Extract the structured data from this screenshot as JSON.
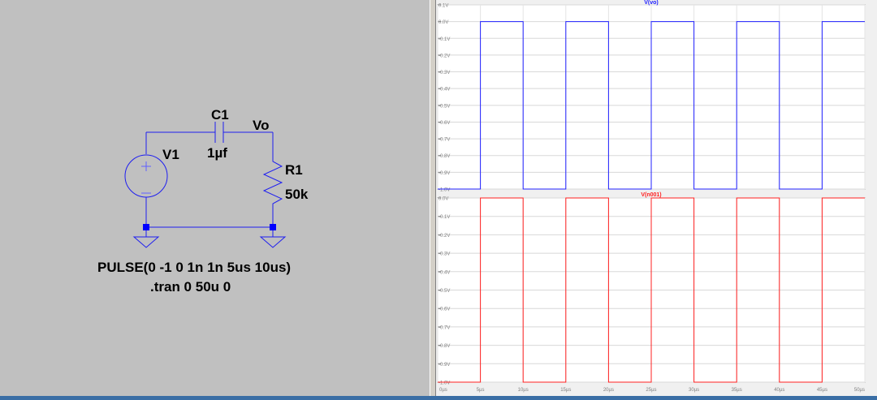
{
  "schematic": {
    "capacitor": {
      "name": "C1",
      "value": "1µf"
    },
    "node_label": "Vo",
    "source": {
      "name": "V1"
    },
    "resistor": {
      "name": "R1",
      "value": "50k"
    },
    "directive_pulse": "PULSE(0 -1 0 1n 1n 5us 10us)",
    "directive_tran": ".tran 0 50u 0",
    "wire_color": "#1e1ef0",
    "node_color": "#0000ff"
  },
  "plots": [
    {
      "trace": "V(vo)",
      "color": "#2020ff",
      "y_ticks": [
        "0.1V",
        "0.0V",
        "-0.1V",
        "-0.2V",
        "-0.3V",
        "-0.4V",
        "-0.5V",
        "-0.6V",
        "-0.7V",
        "-0.8V",
        "-0.9V",
        "-1.0V"
      ]
    },
    {
      "trace": "V(n001)",
      "color": "#ff2020",
      "y_ticks": [
        "0.0V",
        "-0.1V",
        "-0.2V",
        "-0.3V",
        "-0.4V",
        "-0.5V",
        "-0.6V",
        "-0.7V",
        "-0.8V",
        "-0.9V",
        "-1.0V"
      ]
    }
  ],
  "x_ticks": [
    "0µs",
    "5µs",
    "10µs",
    "15µs",
    "20µs",
    "25µs",
    "30µs",
    "35µs",
    "40µs",
    "45µs",
    "50µs"
  ],
  "chart_data": [
    {
      "type": "line",
      "title": "V(vo)",
      "xlabel": "",
      "ylabel": "",
      "xlim": [
        0,
        50
      ],
      "ylim": [
        -1.0,
        0.1
      ],
      "x_unit": "µs",
      "series": [
        {
          "name": "V(vo)",
          "color": "#2020ff",
          "x": [
            0,
            5,
            5,
            10,
            10,
            15,
            15,
            20,
            20,
            25,
            25,
            30,
            30,
            35,
            35,
            40,
            40,
            45,
            45,
            50
          ],
          "y": [
            -1,
            -1,
            0,
            0,
            -1,
            -1,
            0,
            0,
            -1,
            -1,
            0,
            0,
            -1,
            -1,
            0,
            0,
            -1,
            -1,
            0,
            0
          ]
        }
      ],
      "grid": true
    },
    {
      "type": "line",
      "title": "V(n001)",
      "xlabel": "",
      "ylabel": "",
      "xlim": [
        0,
        50
      ],
      "ylim": [
        -1.0,
        0.0
      ],
      "x_unit": "µs",
      "series": [
        {
          "name": "V(n001)",
          "color": "#ff2020",
          "x": [
            0,
            5,
            5,
            10,
            10,
            15,
            15,
            20,
            20,
            25,
            25,
            30,
            30,
            35,
            35,
            40,
            40,
            45,
            45,
            50
          ],
          "y": [
            -1,
            -1,
            0,
            0,
            -1,
            -1,
            0,
            0,
            -1,
            -1,
            0,
            0,
            -1,
            -1,
            0,
            0,
            -1,
            -1,
            0,
            0
          ]
        }
      ],
      "grid": true
    }
  ]
}
